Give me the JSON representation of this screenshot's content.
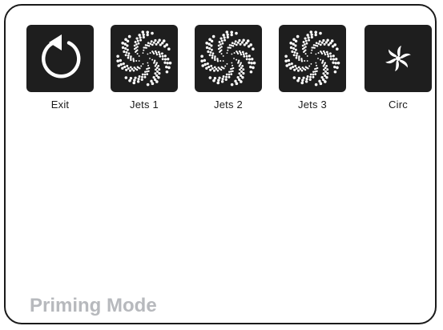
{
  "buttons": [
    {
      "label": "Exit",
      "icon": "exit-arrow-icon"
    },
    {
      "label": "Jets 1",
      "icon": "jets-swirl-icon"
    },
    {
      "label": "Jets 2",
      "icon": "jets-swirl-icon"
    },
    {
      "label": "Jets 3",
      "icon": "jets-swirl-icon"
    },
    {
      "label": "Circ",
      "icon": "circ-pinwheel-icon"
    }
  ],
  "status": {
    "mode": "Priming Mode"
  },
  "colors": {
    "tile": "#1e1e1e",
    "icon": "#ffffff",
    "border": "#1a1a1a",
    "mode_text": "#b7b9bd"
  }
}
